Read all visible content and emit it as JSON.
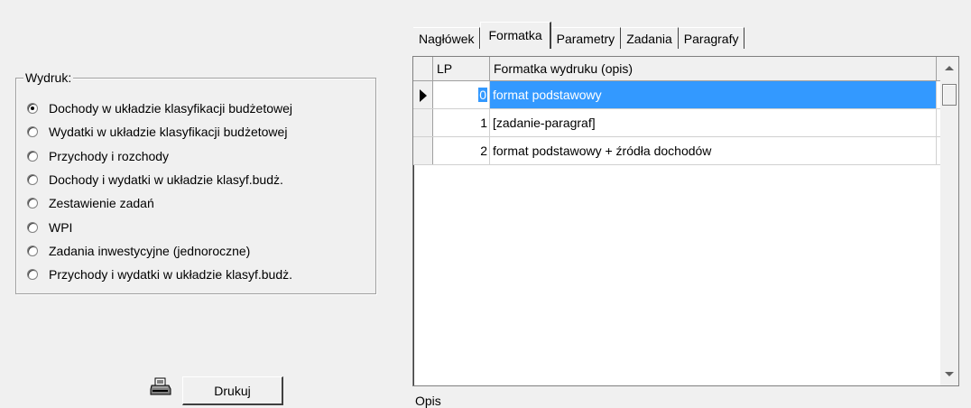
{
  "left_panel": {
    "group_title": "Wydruk:",
    "options": [
      {
        "label": "Dochody w układzie klasyfikacji budżetowej",
        "checked": true
      },
      {
        "label": "Wydatki w układzie klasyfikacji budżetowej",
        "checked": false
      },
      {
        "label": "Przychody i rozchody",
        "checked": false
      },
      {
        "label": "Dochody i wydatki w układzie klasyf.budż.",
        "checked": false
      },
      {
        "label": "Zestawienie zadań",
        "checked": false
      },
      {
        "label": "WPI",
        "checked": false
      },
      {
        "label": "Zadania inwestycyjne (jednoroczne)",
        "checked": false
      },
      {
        "label": "Przychody i wydatki w układzie klasyf.budż.",
        "checked": false
      }
    ],
    "print_button": "Drukuj",
    "print_icon": "printer-icon"
  },
  "tabs": [
    {
      "label": "Nagłówek",
      "active": false
    },
    {
      "label": "Formatka",
      "active": true
    },
    {
      "label": "Parametry",
      "active": false
    },
    {
      "label": "Zadania",
      "active": false
    },
    {
      "label": "Paragrafy",
      "active": false
    }
  ],
  "grid": {
    "columns": [
      "LP",
      "Formatka wydruku (opis)"
    ],
    "rows": [
      {
        "lp": "0",
        "desc": "format podstawowy",
        "selected": true
      },
      {
        "lp": "1",
        "desc": "[zadanie-paragraf]",
        "selected": false
      },
      {
        "lp": "2",
        "desc": "format podstawowy + źródła dochodów",
        "selected": false
      }
    ]
  },
  "bottom_label": "Opis",
  "colors": {
    "selection": "#3399ff",
    "background": "#f0f0f0"
  }
}
